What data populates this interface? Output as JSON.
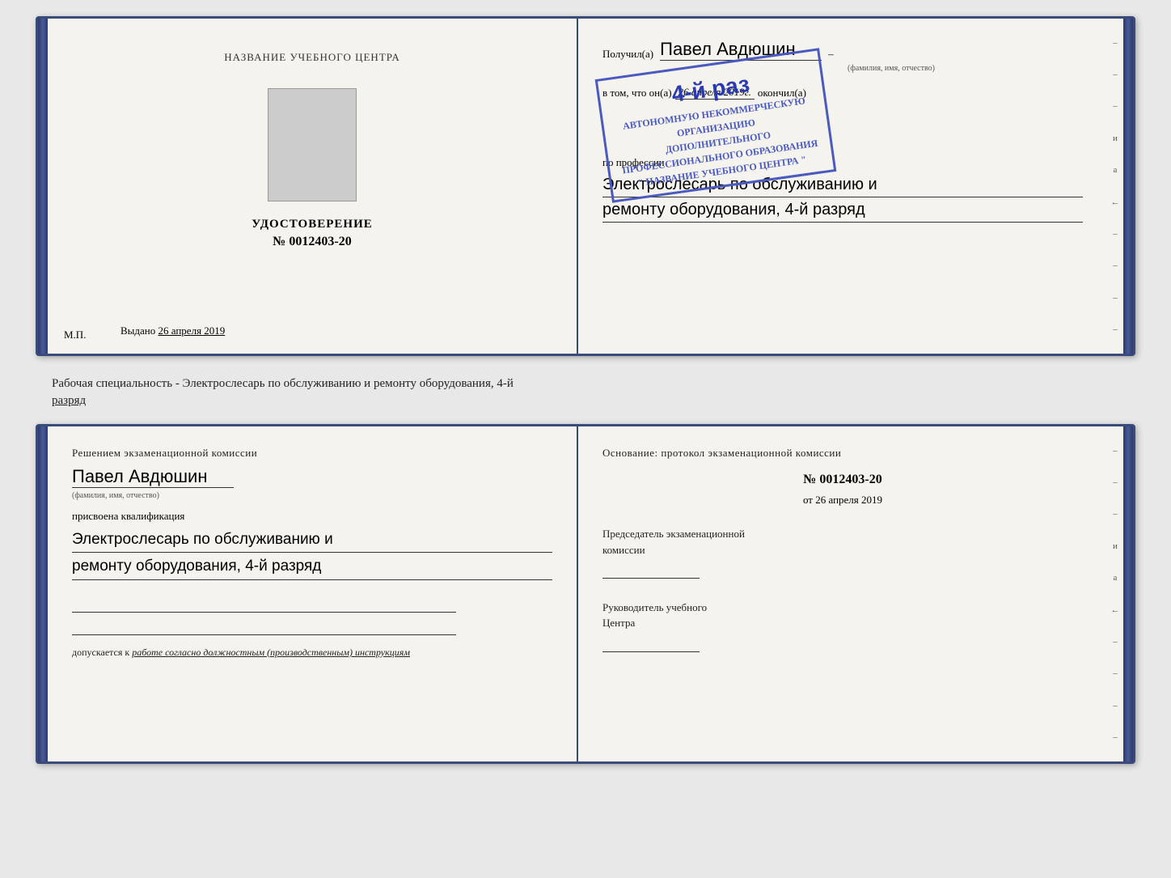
{
  "topBooklet": {
    "leftPage": {
      "centerTitle": "НАЗВАНИЕ УЧЕБНОГО ЦЕНТРА",
      "photoAlt": "photo placeholder",
      "udostovereniLabel": "УДОСТОВЕРЕНИЕ",
      "numberLabel": "№ 0012403-20",
      "vydanoLabel": "Выдано",
      "vydanoDate": "26 апреля 2019",
      "mpLabel": "М.П."
    },
    "rightPage": {
      "poluchilLabel": "Получил(а)",
      "recipientName": "Павел Авдюшин",
      "fioSubLabel": "(фамилия, имя, отчество)",
      "vtomLabel": "в том, что он(а)",
      "date": "26 апреля 2019г.",
      "okonchilLabel": "окончил(а)",
      "stampLine1": "4-й раз",
      "stampLine2": "АВТОНОМНУЮ НЕКОММЕРЧЕСКУЮ ОРГАНИЗАЦИЮ",
      "stampLine3": "ДОПОЛНИТЕЛЬНОГО ПРОФЕССИОНАЛЬНОГО ОБРАЗОВАНИЯ",
      "stampLine4": "\" НАЗВАНИЕ УЧЕБНОГО ЦЕНТРА \"",
      "poProf": "по профессии",
      "profLine1": "Электрослесарь по обслуживанию и",
      "profLine2": "ремонту оборудования, 4-й разряд"
    }
  },
  "middleText": {
    "line1": "Рабочая специальность - Электрослесарь по обслуживанию и ремонту оборудования, 4-й",
    "line2": "разряд"
  },
  "bottomBooklet": {
    "leftPage": {
      "resheniemTitle": "Решением экзаменационной комиссии",
      "personName": "Павел Авдюшин",
      "fioSubLabel": "(фамилия, имя, отчество)",
      "prisvoenaLabel": "присвоена квалификация",
      "kvalifLine1": "Электрослесарь по обслуживанию и",
      "kvalifLine2": "ремонту оборудования, 4-й разряд",
      "dopuskaetsyaLabel": "допускается к",
      "dopuskaetsyaText": "работе согласно должностным (производственным) инструкциям"
    },
    "rightPage": {
      "osnovanieTitel": "Основание: протокол экзаменационной комиссии",
      "protocolNumber": "№ 0012403-20",
      "otLabel": "от",
      "otDate": "26 апреля 2019",
      "chairmanLabel": "Председатель экзаменационной",
      "chairmanLabel2": "комиссии",
      "rukovoditelLabel": "Руководитель учебного",
      "rukovoditelLabel2": "Центра"
    }
  },
  "edgeDashes": {
    "marks": [
      "–",
      "–",
      "–",
      "и",
      "а",
      "←",
      "–",
      "–",
      "–",
      "–"
    ]
  }
}
